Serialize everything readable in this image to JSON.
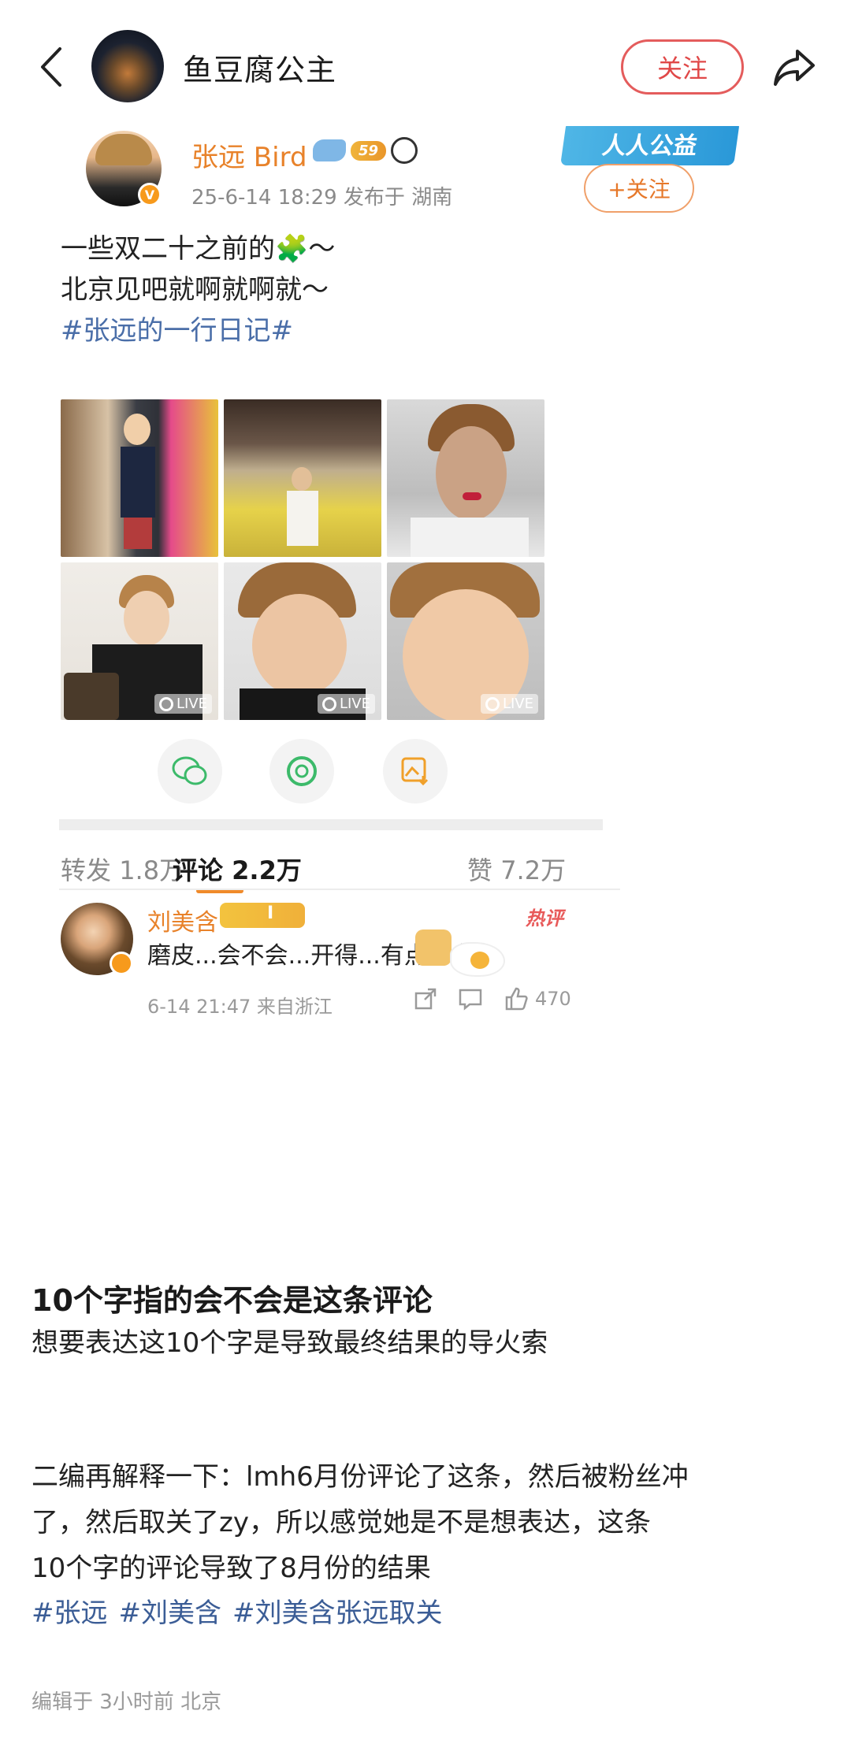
{
  "header": {
    "author_name": "鱼豆腐公主",
    "follow_label": "关注"
  },
  "embed": {
    "author_name": "张远 Bird",
    "level_badge": "59",
    "meta": "25-6-14 18:29  发布于 湖南",
    "sticker_text": "人人公益",
    "follow_label": "+关注",
    "text_lines": [
      "一些双二十之前的🧩～",
      "北京见吧就啊就啊就～"
    ],
    "hashtag": "#张远的一行日记#",
    "live_label": "LIVE",
    "stats": {
      "repost_label": "转发",
      "repost_count": "1.8万",
      "comment_label": "评论",
      "comment_count": "2.2万",
      "like_label": "赞",
      "like_count": "7.2万"
    },
    "comment": {
      "name": "刘美含",
      "crown_level": "I",
      "hot_label": "热评",
      "text": "磨皮...会不会...开得...有点...大...",
      "meta": "6-14 21:47  来自浙江",
      "likes": "470"
    }
  },
  "article": {
    "title": "10个字指的会不会是这条评论",
    "para1": "想要表达这10个字是导致最终结果的导火索",
    "para2_line1": "二编再解释一下：lmh6月份评论了这条，然后被粉丝冲",
    "para2_line2": "了，然后取关了zy，所以感觉她是不是想表达，这条",
    "para2_line3": "10个字的评论导致了8月份的结果",
    "hashtags": [
      "#张远",
      "#刘美含",
      "#刘美含张远取关"
    ],
    "edited": "编辑于 3小时前 北京"
  },
  "colors": {
    "accent_red": "#e04848",
    "name_orange": "#e8822a",
    "hashtag_blue": "#3b5d96"
  }
}
